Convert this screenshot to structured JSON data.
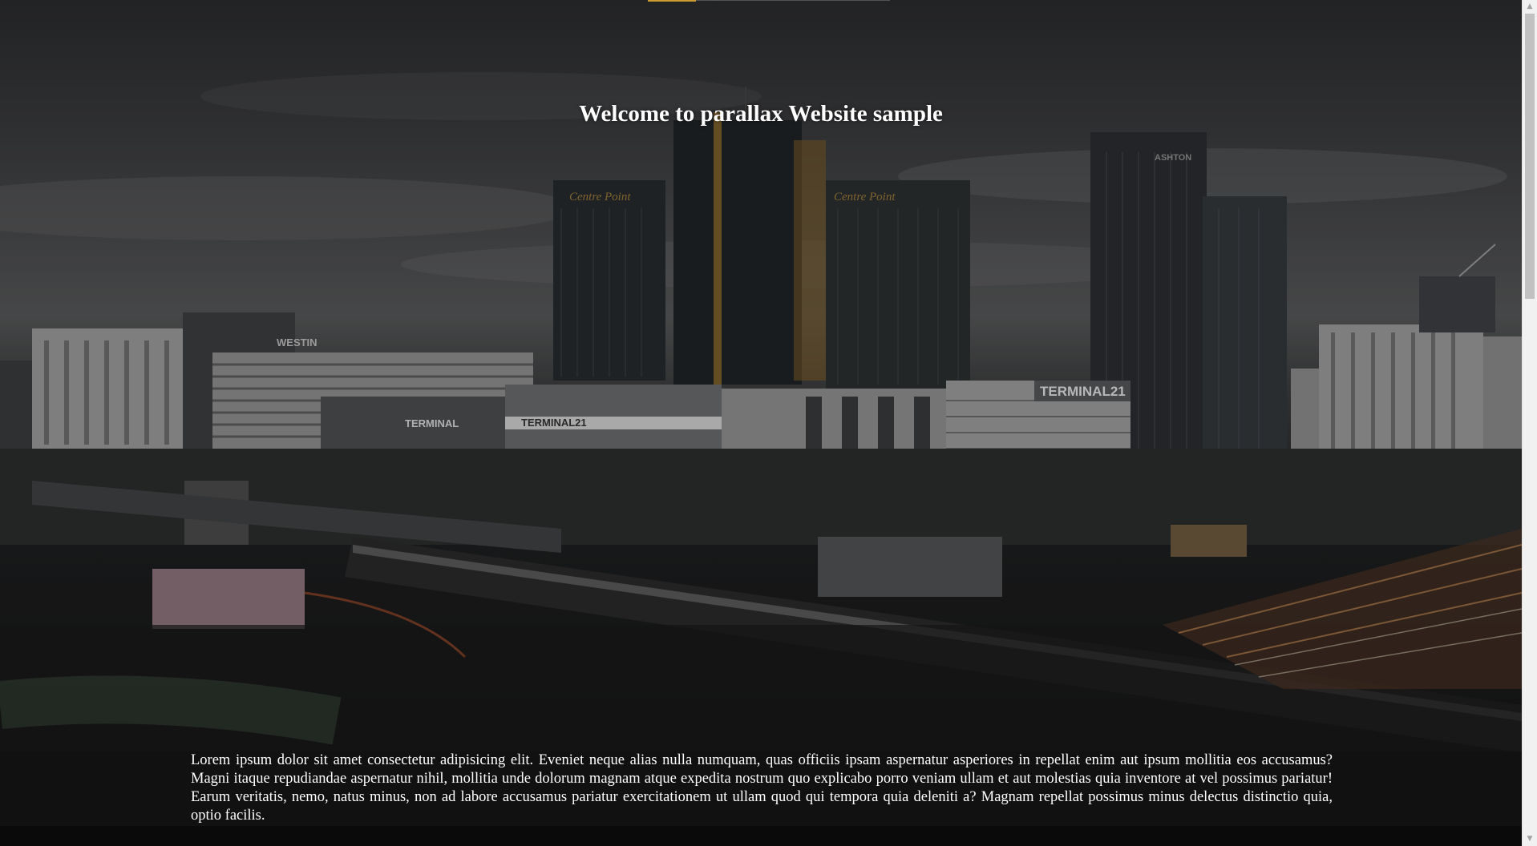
{
  "page": {
    "hero_title": "Welcome to parallax Website sample",
    "body_text": "Lorem ipsum dolor sit amet consectetur adipisicing elit. Eveniet neque alias nulla numquam, quas officiis ipsam aspernatur asperiores in repellat enim aut ipsum mollitia eos accusamus? Magni itaque repudiandae aspernatur nihil, mollitia unde dolorum magnam atque expedita nostrum quo explicabo porro veniam ullam et aut molestias quia inventore at vel possimus pariatur! Earum veritatis, nemo, natus minus, non ad labore accusamus pariatur exercitationem ut ullam quod qui tempora quia deleniti a? Magnam repellat possimus minus delectus distinctio quia, optio facilis."
  },
  "hero_image": {
    "building_signs": [
      "Centre Point",
      "Centre Point",
      "WESTIN",
      "TERMINAL",
      "TERMINAL 21",
      "TERMINAL21",
      "ASHTON"
    ]
  },
  "scrollbar": {
    "up_icon": "chevron-up-icon",
    "down_icon": "chevron-down-icon"
  },
  "colors": {
    "nav_accent": "#c99a2e",
    "text_section_bg": "#111111",
    "text_color": "#ffffff"
  }
}
